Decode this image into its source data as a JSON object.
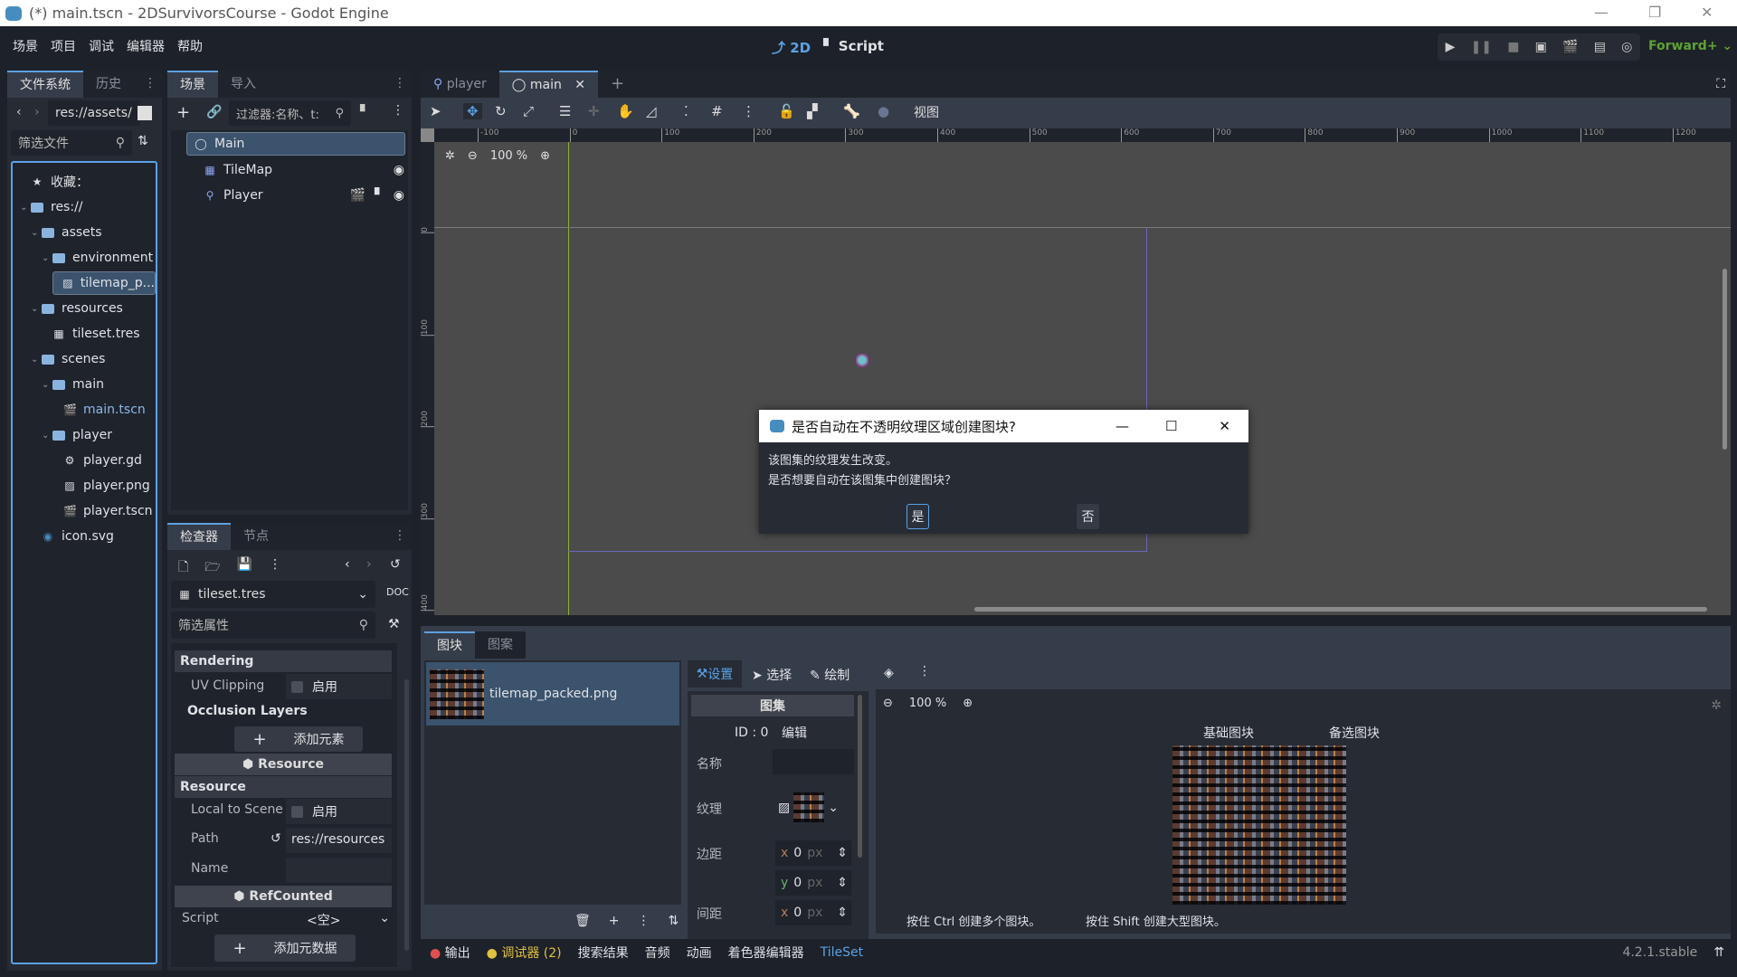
{
  "window": {
    "title": "(*) main.tscn - 2DSurvivorsCourse - Godot Engine"
  },
  "menu": [
    "场景",
    "项目",
    "调试",
    "编辑器",
    "帮助"
  ],
  "modes": {
    "2d": "2D",
    "script": "Script"
  },
  "renderer": "Forward+",
  "filesystem": {
    "tabs": [
      "文件系统",
      "历史"
    ],
    "path": "res://assets/",
    "filter_placeholder": "筛选文件",
    "items": [
      {
        "label": "收藏：",
        "icon": "star-icon",
        "depth": 0
      },
      {
        "label": "res://",
        "icon": "folder-icon",
        "depth": 0
      },
      {
        "label": "assets",
        "icon": "folder-icon",
        "depth": 1
      },
      {
        "label": "environment",
        "icon": "folder-icon",
        "depth": 2
      },
      {
        "label": "tilemap_p...",
        "icon": "image-icon",
        "depth": 3,
        "selected": true
      },
      {
        "label": "resources",
        "icon": "folder-icon",
        "depth": 1
      },
      {
        "label": "tileset.tres",
        "icon": "tileset-icon",
        "depth": 2
      },
      {
        "label": "scenes",
        "icon": "folder-icon",
        "depth": 1
      },
      {
        "label": "main",
        "icon": "folder-icon",
        "depth": 2
      },
      {
        "label": "main.tscn",
        "icon": "scene-icon",
        "depth": 3,
        "accent": true
      },
      {
        "label": "player",
        "icon": "folder-icon",
        "depth": 2
      },
      {
        "label": "player.gd",
        "icon": "gear-icon",
        "depth": 3
      },
      {
        "label": "player.png",
        "icon": "image-icon",
        "depth": 3
      },
      {
        "label": "player.tscn",
        "icon": "scene-icon",
        "depth": 3
      },
      {
        "label": "icon.svg",
        "icon": "godot-icon",
        "depth": 1
      }
    ]
  },
  "scene": {
    "tabs": [
      "场景",
      "导入"
    ],
    "filter_placeholder": "过滤器:名称、t:",
    "nodes": [
      {
        "label": "Main",
        "icon": "node2d-icon"
      },
      {
        "label": "TileMap",
        "icon": "tilemap-icon"
      },
      {
        "label": "Player",
        "icon": "player-icon"
      }
    ]
  },
  "inspector": {
    "tabs": [
      "检查器",
      "节点"
    ],
    "resource": "tileset.tres",
    "filter_placeholder": "筛选属性",
    "rendering": "Rendering",
    "uv_clipping": "UV Clipping",
    "enable": "启用",
    "occlusion_layers": "Occlusion Layers",
    "add_element": "添加元素",
    "resource_header": "Resource",
    "resource_section": "Resource",
    "local_to_scene": "Local to Scene",
    "path_label": "Path",
    "path_value": "res://resources",
    "name_label": "Name",
    "refcounted": "RefCounted",
    "script_label": "Script",
    "script_value": "<空>",
    "add_metadata": "添加元数据"
  },
  "editor": {
    "tabs": [
      "player",
      "main"
    ],
    "view_menu": "视图",
    "zoom": "100 %",
    "ruler_x": [
      "-100",
      "0",
      "100",
      "200",
      "300",
      "400",
      "500",
      "600",
      "700",
      "800",
      "900",
      "1000",
      "1100",
      "1200"
    ],
    "ruler_y": [
      "0",
      "100",
      "200",
      "300",
      "400"
    ]
  },
  "dialog": {
    "title": "是否自动在不透明纹理区域创建图块?",
    "line1": "该图集的纹理发生改变。",
    "line2": "是否想要自动在该图集中创建图块？",
    "yes": "是",
    "no": "否"
  },
  "tileset": {
    "tabs": [
      "图块",
      "图案"
    ],
    "source": "tilemap_packed.png",
    "tools": [
      "设置",
      "选择",
      "绘制"
    ],
    "atlas_header": "图集",
    "id_label": "ID : 0",
    "edit": "编辑",
    "name_label": "名称",
    "texture_label": "纹理",
    "margin_label": "边距",
    "separation_label": "间距",
    "x": "x",
    "y": "y",
    "zero": "0",
    "px": "px",
    "zoom": "100 %",
    "base_tiles": "基础图块",
    "alt_tiles": "备选图块",
    "hint_ctrl": "按住 Ctrl 创建多个图块。",
    "hint_shift": "按住 Shift 创建大型图块。"
  },
  "bottom": {
    "items": [
      "输出",
      "调试器 (2)",
      "搜索结果",
      "音频",
      "动画",
      "着色器编辑器",
      "TileSet"
    ],
    "version": "4.2.1.stable"
  },
  "colors": {
    "accent": "#5aa2e6",
    "renderer": "#5ea333",
    "debugger_dot": "#e0c040",
    "output_dot": "#e05050"
  }
}
